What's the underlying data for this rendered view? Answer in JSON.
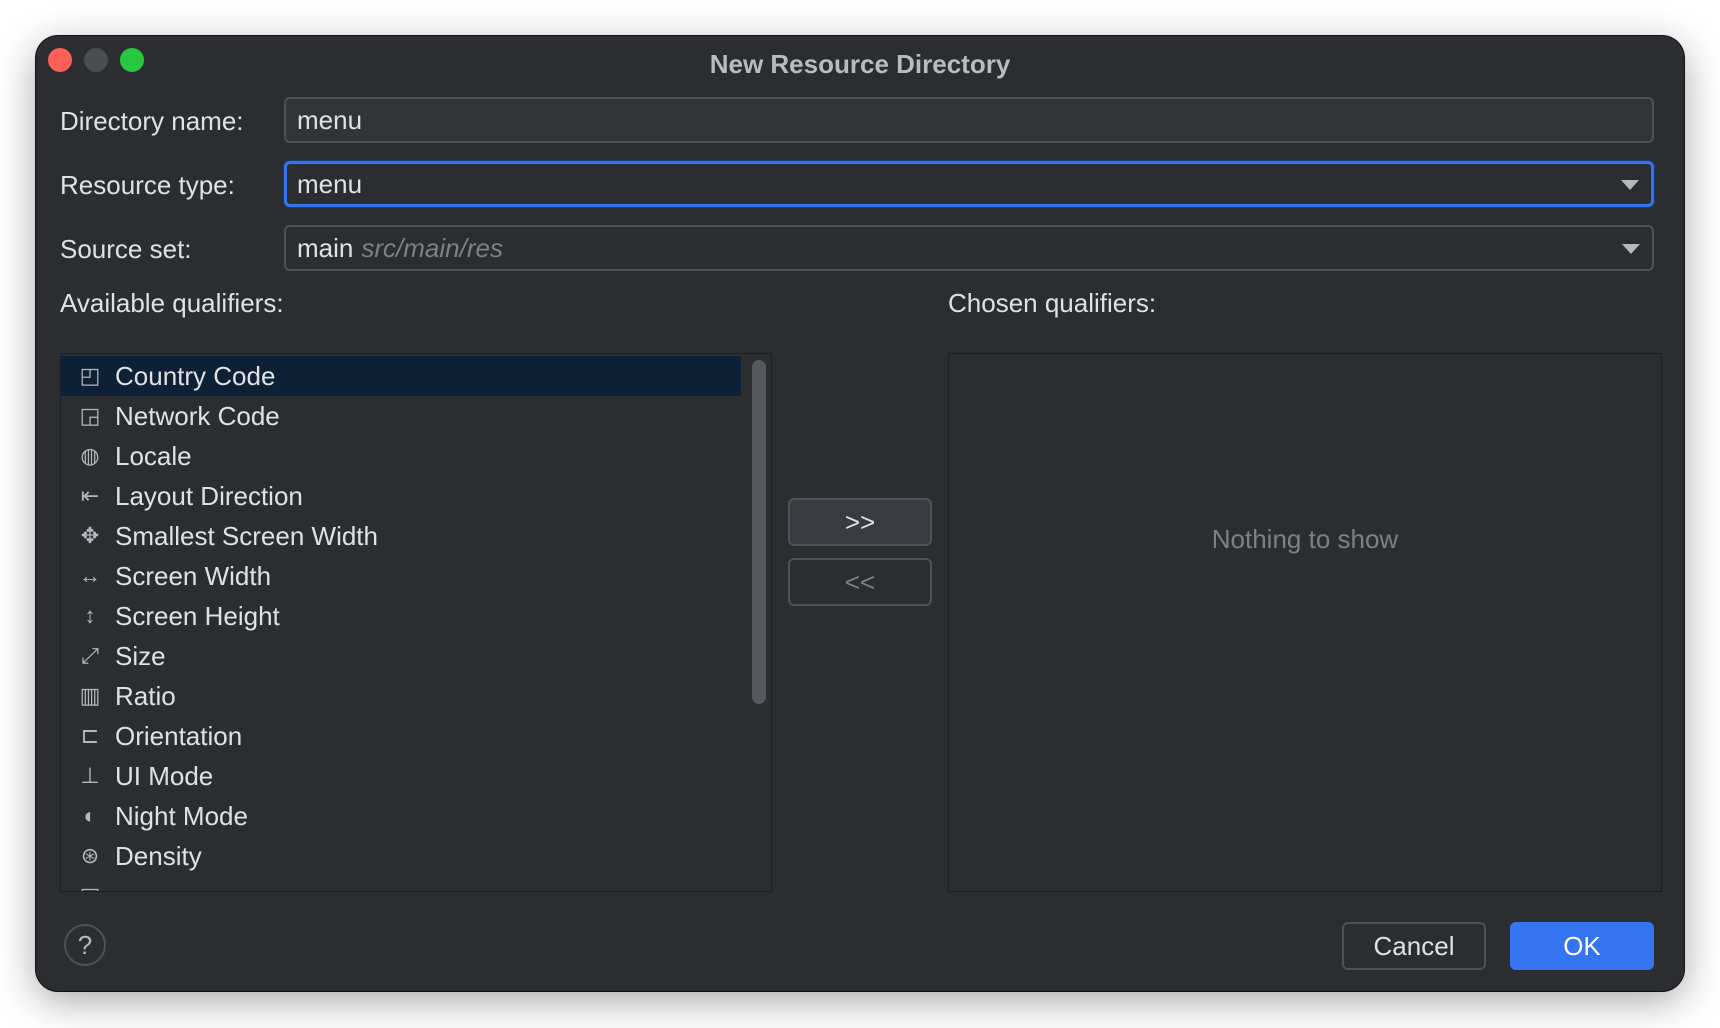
{
  "window": {
    "title": "New Resource Directory"
  },
  "form": {
    "directory_name_label": "Directory name:",
    "directory_name_value": "menu",
    "resource_type_label": "Resource type:",
    "resource_type_value": "menu",
    "source_set_label": "Source set:",
    "source_set_value": "main",
    "source_set_hint": "src/main/res"
  },
  "qualifiers": {
    "available_label": "Available qualifiers:",
    "chosen_label": "Chosen qualifiers:",
    "empty_text": "Nothing to show",
    "add_button": ">>",
    "remove_button": "<<",
    "items": [
      {
        "label": "Country Code",
        "icon": "country-code-icon"
      },
      {
        "label": "Network Code",
        "icon": "network-code-icon"
      },
      {
        "label": "Locale",
        "icon": "globe-icon"
      },
      {
        "label": "Layout Direction",
        "icon": "layout-direction-icon"
      },
      {
        "label": "Smallest Screen Width",
        "icon": "smallest-screen-width-icon"
      },
      {
        "label": "Screen Width",
        "icon": "screen-width-icon"
      },
      {
        "label": "Screen Height",
        "icon": "screen-height-icon"
      },
      {
        "label": "Size",
        "icon": "size-icon"
      },
      {
        "label": "Ratio",
        "icon": "ratio-icon"
      },
      {
        "label": "Orientation",
        "icon": "orientation-icon"
      },
      {
        "label": "UI Mode",
        "icon": "ui-mode-icon"
      },
      {
        "label": "Night Mode",
        "icon": "night-mode-icon"
      },
      {
        "label": "Density",
        "icon": "density-icon"
      }
    ],
    "selected_index": 0
  },
  "footer": {
    "help": "?",
    "cancel": "Cancel",
    "ok": "OK"
  },
  "colors": {
    "background": "#2b2d30",
    "accent": "#3574f0",
    "selection": "#0d2035",
    "close": "#ff5f57",
    "minimize": "#4a4c50",
    "maximize": "#28c840"
  }
}
